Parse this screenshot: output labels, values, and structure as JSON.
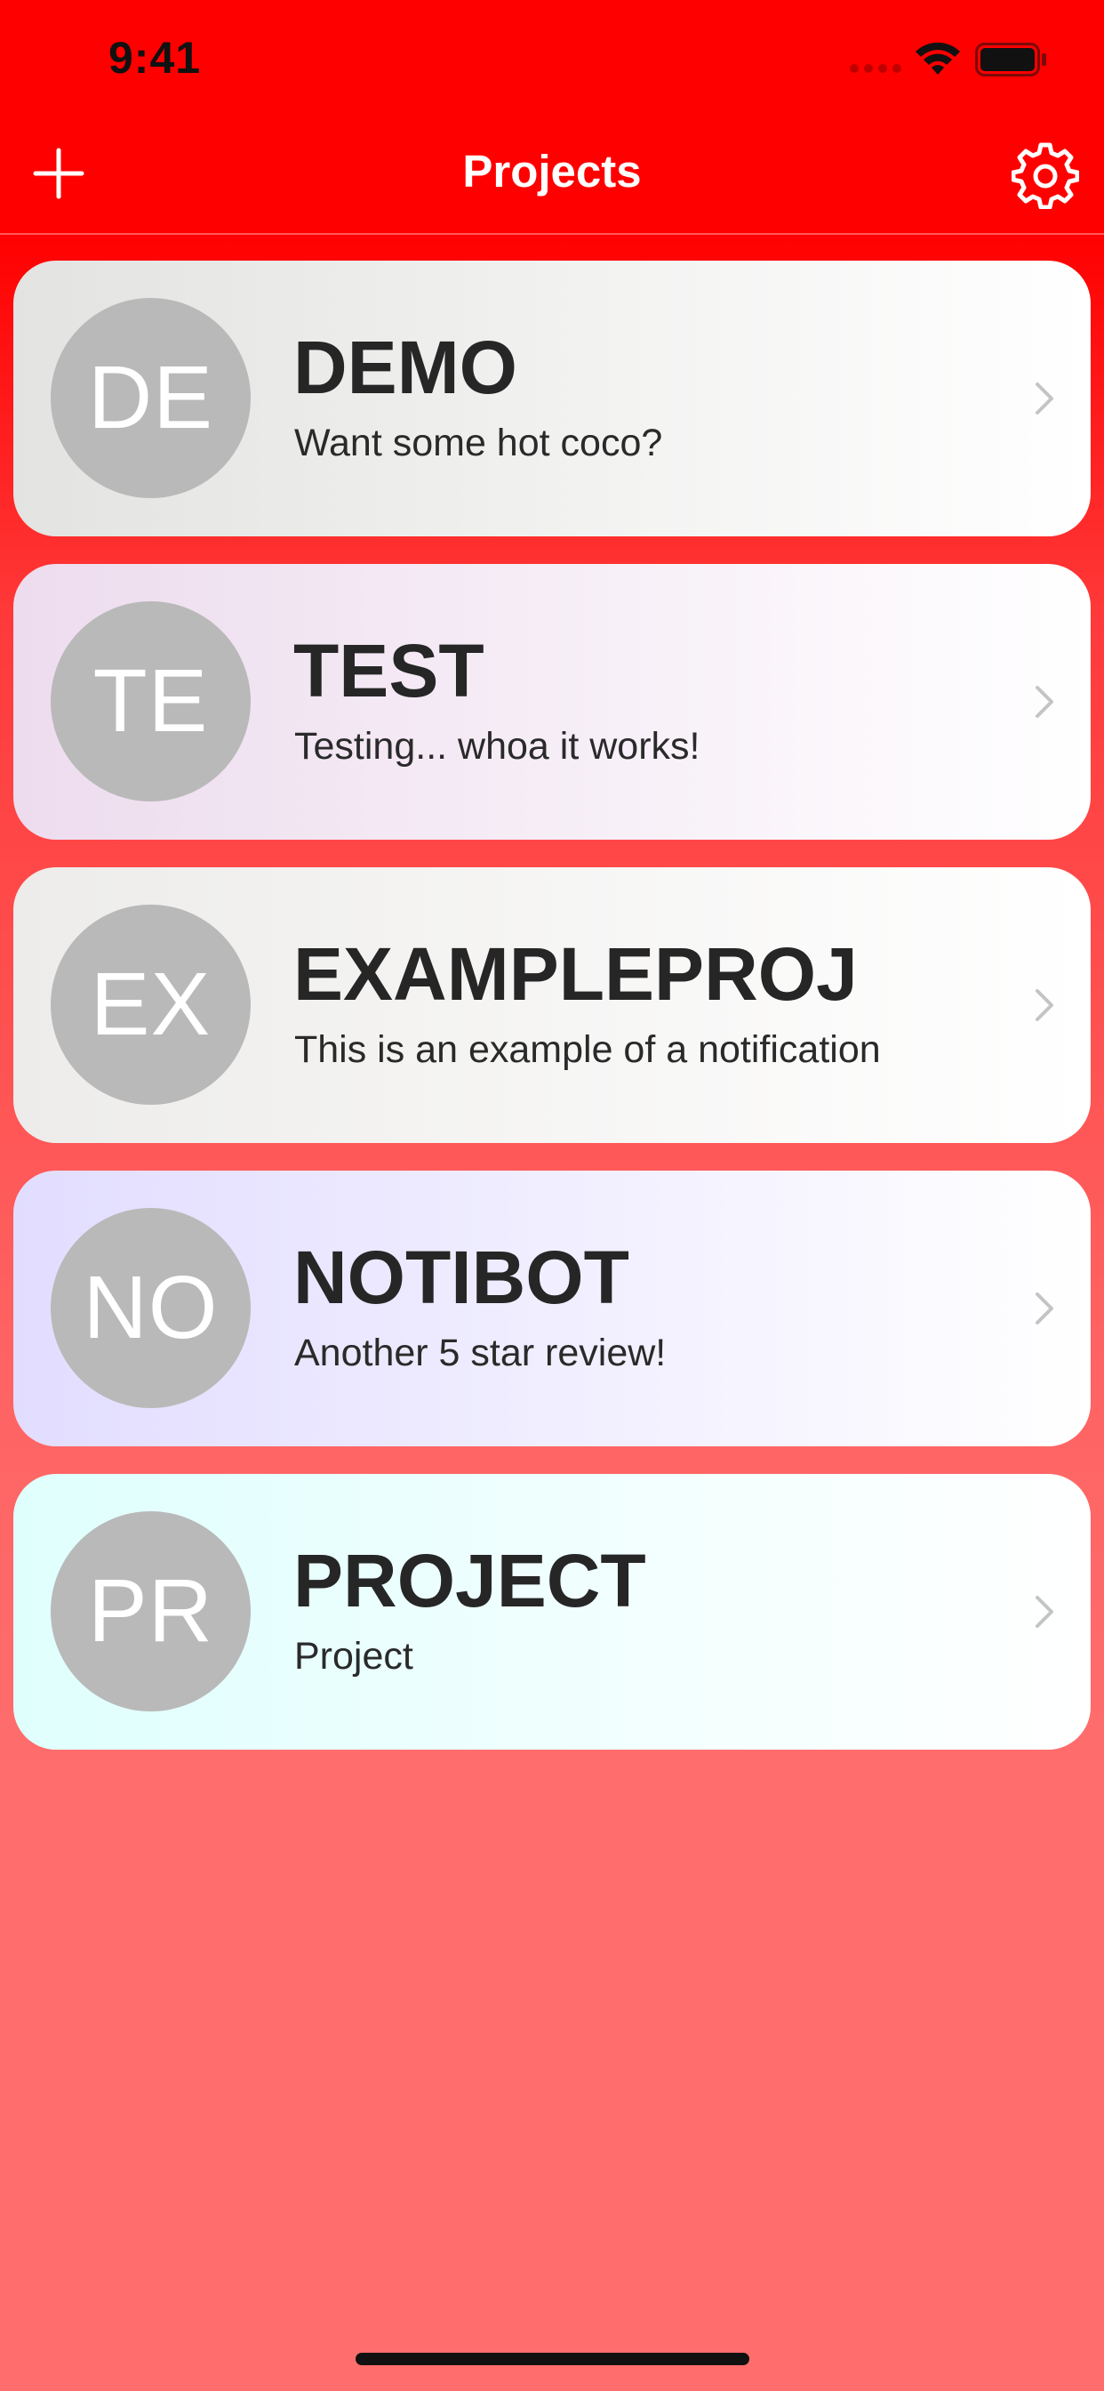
{
  "status_bar": {
    "time": "9:41"
  },
  "nav": {
    "title": "Projects",
    "add_icon": "plus-icon",
    "settings_icon": "gear-icon"
  },
  "projects": [
    {
      "initials": "DE",
      "title": "DEMO",
      "subtitle": "Want some hot coco?",
      "gradient_start": "#e3e3e1",
      "gradient_end": "#ffffff"
    },
    {
      "initials": "TE",
      "title": "TEST",
      "subtitle": "Testing... whoa it works!",
      "gradient_start": "#eddcee",
      "gradient_end": "#ffffff"
    },
    {
      "initials": "EX",
      "title": "EXAMPLEPROJ",
      "subtitle": "This is an example of a notification",
      "gradient_start": "#edecea",
      "gradient_end": "#ffffff"
    },
    {
      "initials": "NO",
      "title": "NOTIBOT",
      "subtitle": "Another 5 star review!",
      "gradient_start": "#e2ddff",
      "gradient_end": "#ffffff"
    },
    {
      "initials": "PR",
      "title": "PROJECT",
      "subtitle": "Project",
      "gradient_start": "#dffffd",
      "gradient_end": "#ffffff"
    }
  ],
  "colors": {
    "header": "#ff0000",
    "background_bottom": "#ff6d6d",
    "avatar": "#b9b9b9",
    "chevron": "#c4c4c4"
  }
}
